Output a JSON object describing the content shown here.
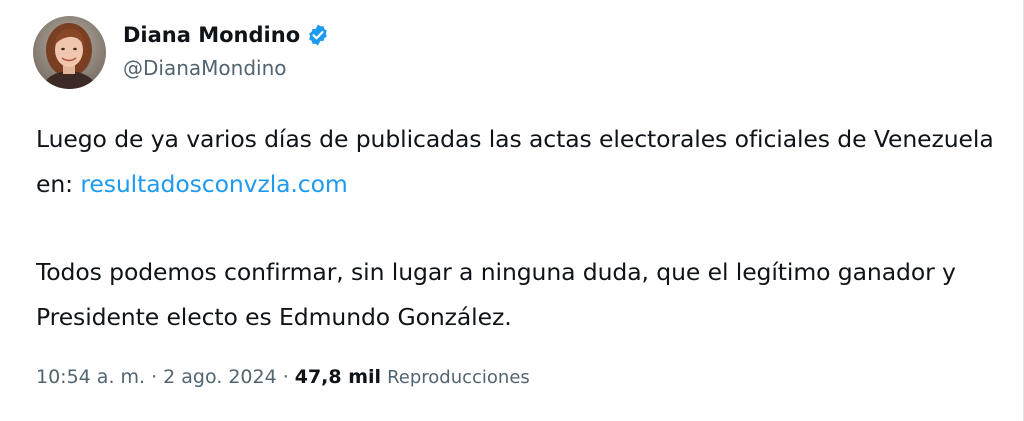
{
  "author": {
    "display_name": "Diana Mondino",
    "handle": "@DianaMondino",
    "verified_icon": "verified-badge-icon",
    "avatar_icon": "avatar"
  },
  "tweet": {
    "paragraph_1_text": "Luego de ya varios días de publicadas las actas electorales oficiales de Venezuela en: ",
    "paragraph_1_link": "resultadosconvzla.com",
    "paragraph_2_text": "Todos podemos confirmar, sin lugar a ninguna duda, que el legítimo ganador y Presidente electo es Edmundo González."
  },
  "meta": {
    "time": "10:54 a. m.",
    "separator": "·",
    "date": "2 ago. 2024",
    "views_count": "47,8 mil",
    "views_label": "Reproducciones"
  },
  "colors": {
    "text_primary": "#0f1419",
    "text_secondary": "#536471",
    "link": "#1d9bf0",
    "verified": "#1d9bf0"
  }
}
